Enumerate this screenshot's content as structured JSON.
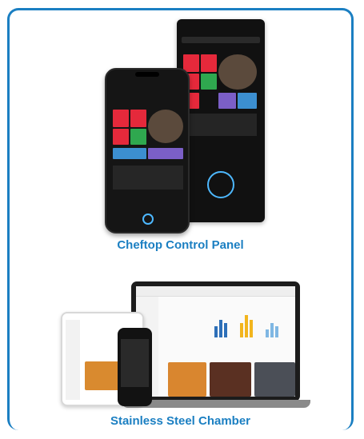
{
  "products": [
    {
      "caption": "Cheftop Control Panel",
      "image_alt": "cheftop-devices-image"
    },
    {
      "caption": "Stainless Steel Chamber",
      "image_alt": "stainless-steel-chamber-devices-image"
    }
  ],
  "colors": {
    "accent": "#1b7fc2"
  }
}
